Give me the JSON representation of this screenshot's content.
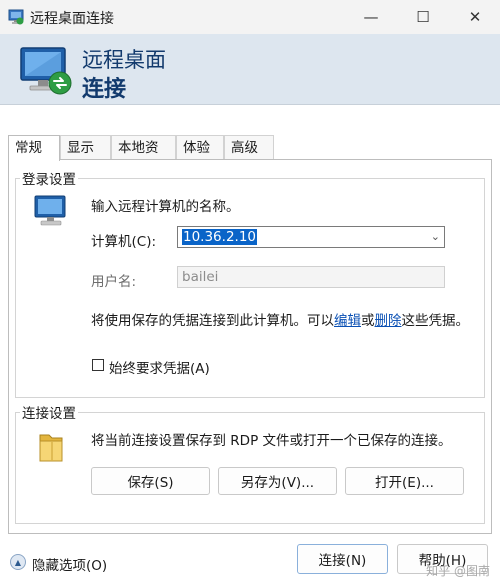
{
  "window": {
    "title": "远程桌面连接",
    "controls": {
      "minimize": "—",
      "maximize": "☐",
      "close": "✕"
    }
  },
  "banner": {
    "line1": "远程桌面",
    "line2": "连接"
  },
  "tabs": [
    {
      "label": "常规",
      "active": true
    },
    {
      "label": "显示",
      "active": false
    },
    {
      "label": "本地资源",
      "active": false
    },
    {
      "label": "体验",
      "active": false
    },
    {
      "label": "高级",
      "active": false
    }
  ],
  "login": {
    "group_title": "登录设置",
    "prompt": "输入远程计算机的名称。",
    "computer_label": "计算机(C):",
    "computer_value": "10.36.2.10",
    "username_label": "用户名:",
    "username_value": "bailei",
    "creds_note_prefix": "将使用保存的凭据连接到此计算机。可以",
    "edit_link": "编辑",
    "or_text": "或",
    "delete_link": "删除",
    "creds_note_suffix": "这些凭据。",
    "always_ask_label": "始终要求凭据(A)",
    "always_ask_checked": false
  },
  "connection": {
    "group_title": "连接设置",
    "description": "将当前连接设置保存到 RDP 文件或打开一个已保存的连接。",
    "save_button": "保存(S)",
    "save_as_button": "另存为(V)...",
    "open_button": "打开(E)..."
  },
  "footer": {
    "hide_options": "隐藏选项(O)",
    "connect_button": "连接(N)",
    "help_button": "帮助(H)"
  },
  "watermark": "知乎 @图南",
  "icons": {
    "app": "remote-desktop-icon",
    "folder": "folder-icon",
    "computer": "computer-icon"
  },
  "colors": {
    "banner_bg": "#dde6ef",
    "banner_text": "#123a6d",
    "link": "#0a50b4",
    "selection": "#0a64c8"
  }
}
